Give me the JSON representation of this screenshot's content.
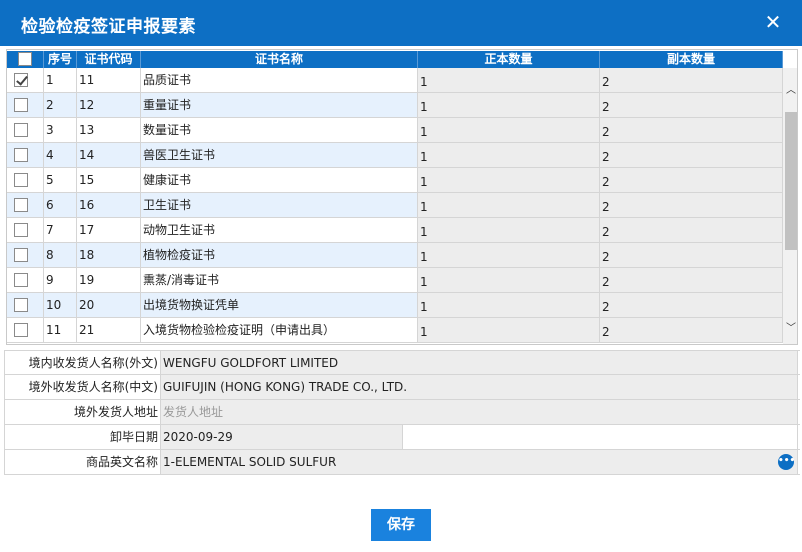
{
  "window": {
    "title": "检验检疫签证申报要素"
  },
  "grid": {
    "columns": [
      "序号",
      "证书代码",
      "证书名称",
      "正本数量",
      "副本数量"
    ],
    "rows": [
      {
        "seq": "1",
        "code": "11",
        "name": "品质证书",
        "orig": "1",
        "copy": "2",
        "checked": true
      },
      {
        "seq": "2",
        "code": "12",
        "name": "重量证书",
        "orig": "1",
        "copy": "2",
        "checked": false
      },
      {
        "seq": "3",
        "code": "13",
        "name": "数量证书",
        "orig": "1",
        "copy": "2",
        "checked": false
      },
      {
        "seq": "4",
        "code": "14",
        "name": "兽医卫生证书",
        "orig": "1",
        "copy": "2",
        "checked": false
      },
      {
        "seq": "5",
        "code": "15",
        "name": "健康证书",
        "orig": "1",
        "copy": "2",
        "checked": false
      },
      {
        "seq": "6",
        "code": "16",
        "name": "卫生证书",
        "orig": "1",
        "copy": "2",
        "checked": false
      },
      {
        "seq": "7",
        "code": "17",
        "name": "动物卫生证书",
        "orig": "1",
        "copy": "2",
        "checked": false
      },
      {
        "seq": "8",
        "code": "18",
        "name": "植物检疫证书",
        "orig": "1",
        "copy": "2",
        "checked": false
      },
      {
        "seq": "9",
        "code": "19",
        "name": "熏蒸/消毒证书",
        "orig": "1",
        "copy": "2",
        "checked": false
      },
      {
        "seq": "10",
        "code": "20",
        "name": "出境货物换证凭单",
        "orig": "1",
        "copy": "2",
        "checked": false
      },
      {
        "seq": "11",
        "code": "21",
        "name": "入境货物检验检疫证明（申请出具）",
        "orig": "1",
        "copy": "2",
        "checked": false
      }
    ]
  },
  "form": {
    "consignee_foreign_label": "境内收发货人名称(外文)",
    "consignee_foreign_value": "WENGFU GOLDFORT LIMITED",
    "overseas_consignor_cn_label": "境外收发货人名称(中文)",
    "overseas_consignor_cn_value": "GUIFUJIN (HONG KONG) TRADE CO., LTD.",
    "overseas_address_label": "境外发货人地址",
    "overseas_address_placeholder": "发货人地址",
    "unload_date_label": "卸毕日期",
    "unload_date_value": "2020-09-29",
    "goods_en_name_label": "商品英文名称",
    "goods_en_name_value": "1-ELEMENTAL SOLID SULFUR"
  },
  "actions": {
    "save_label": "保存"
  },
  "colors": {
    "accent": "#0d6fc4",
    "row_alt": "#e6f1fd",
    "readonly": "#ededed"
  }
}
